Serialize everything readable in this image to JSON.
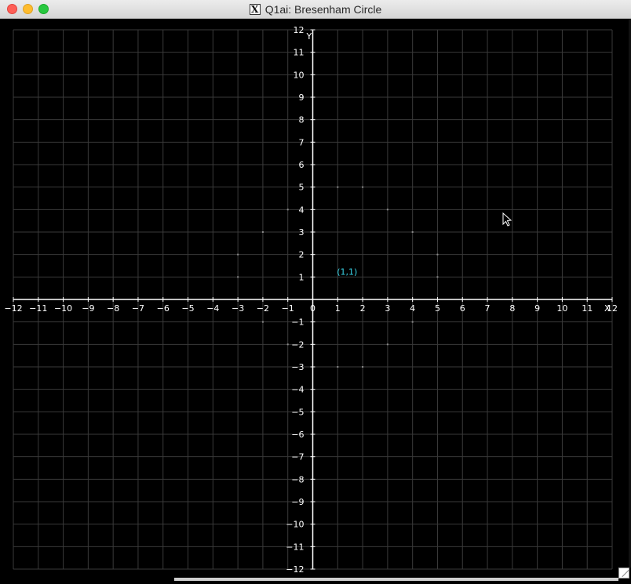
{
  "window": {
    "title": "Q1ai: Bresenham Circle",
    "app_icon": "x11-icon",
    "app_icon_glyph": "X"
  },
  "plot": {
    "background": "#000000",
    "grid_color": "#3a3a3a",
    "axis_color": "#ffffff",
    "label_color": "#ffffff",
    "x_range": [
      -12,
      12
    ],
    "y_range": [
      -12,
      12
    ],
    "x_axis_label": "X",
    "y_axis_label": "Y",
    "x_ticks": [
      -12,
      -11,
      -10,
      -9,
      -8,
      -7,
      -6,
      -5,
      -4,
      -3,
      -2,
      -1,
      0,
      1,
      2,
      3,
      4,
      5,
      6,
      7,
      8,
      9,
      10,
      11,
      12
    ],
    "y_ticks": [
      -12,
      -11,
      -10,
      -9,
      -8,
      -7,
      -6,
      -5,
      -4,
      -3,
      -2,
      -1,
      1,
      2,
      3,
      4,
      5,
      6,
      7,
      8,
      9,
      10,
      11,
      12
    ],
    "center_label": "(1,1)",
    "center_label_color": "#39d3e6",
    "circle_points": [
      [
        1,
        5
      ],
      [
        2,
        5
      ],
      [
        3,
        4
      ],
      [
        4,
        3
      ],
      [
        5,
        2
      ],
      [
        5,
        1
      ],
      [
        4,
        -1
      ],
      [
        3,
        -2
      ],
      [
        2,
        -3
      ],
      [
        1,
        -3
      ],
      [
        -1,
        -2
      ],
      [
        -2,
        -1
      ],
      [
        -3,
        1
      ],
      [
        -3,
        2
      ],
      [
        -2,
        3
      ],
      [
        -1,
        4
      ]
    ]
  }
}
